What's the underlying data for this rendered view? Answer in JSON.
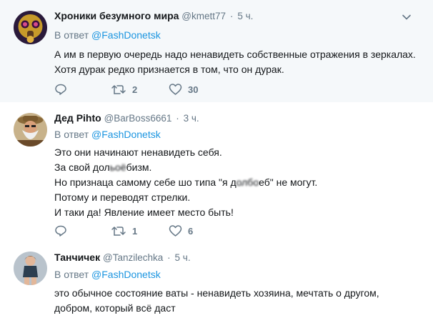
{
  "tweets": [
    {
      "name": "Хроники безумного мира",
      "handle": "@kmett77",
      "dot": "·",
      "time": "5 ч.",
      "reply_prefix": "В ответ",
      "reply_to": "@FashDonetsk",
      "lines": [
        "А им в первую очередь надо ненавидеть собственные отражения в зеркалах.",
        "Хотя дурак редко признается в том, что он дурак."
      ],
      "retweets": "2",
      "likes": "30",
      "avatar_icon": "gas-mask-avatar"
    },
    {
      "name": "Дед Pihto",
      "handle": "@BarBoss6661",
      "dot": "·",
      "time": "3 ч.",
      "reply_prefix": "В ответ",
      "reply_to": "@FashDonetsk",
      "lines": [
        "Это они начинают ненавидеть себя.",
        "За свой долб... бизм.",
        "Но признаца самому себе шо типа \"я долбоеб\" не могут.",
        "Потому и переводят стрелки.",
        "И таки да! Явление имеет место быть!"
      ],
      "line2_a": "За свой дол",
      "line2_blur": "ьоё",
      "line2_b": "бизм.",
      "line3_a": "Но признаца самому себе шо типа \"я д",
      "line3_blur": "олбо",
      "line3_b": "еб\" не могут.",
      "retweets": "1",
      "likes": "6",
      "avatar_icon": "bearded-man-avatar"
    },
    {
      "name": "Танчичек",
      "handle": "@Tanzilechka",
      "dot": "·",
      "time": "5 ч.",
      "reply_prefix": "В ответ",
      "reply_to": "@FashDonetsk",
      "lines": [
        "это обычное состояние ваты - ненавидеть хозяина, мечтать о другом,",
        "добром, который всё даст"
      ],
      "avatar_icon": "woman-avatar"
    }
  ],
  "colors": {
    "link": "#1b95e0",
    "muted": "#657786",
    "text": "#14171a",
    "highlight_bg": "#f5f8fa"
  },
  "icons": [
    "reply-icon",
    "retweet-icon",
    "like-icon",
    "chevron-down-icon"
  ]
}
